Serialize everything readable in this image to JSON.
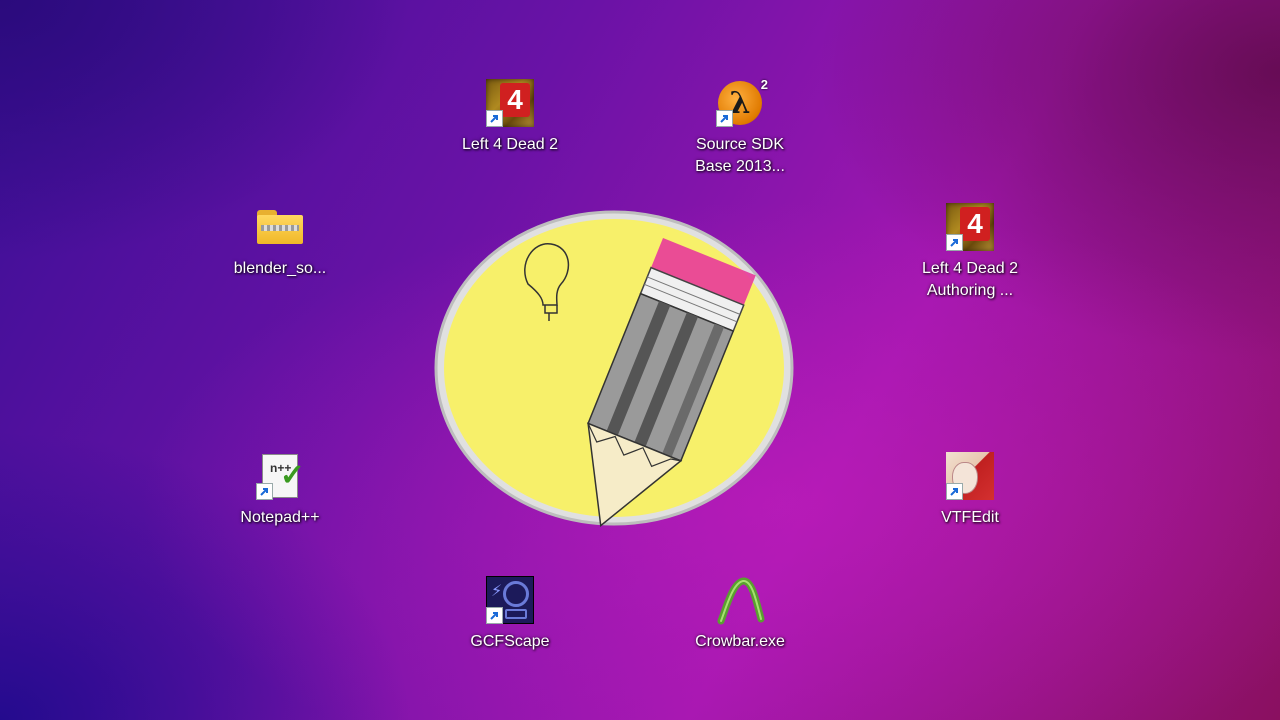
{
  "desktop": {
    "icons": [
      {
        "label": "Left 4 Dead 2",
        "icon": "left4dead2-icon",
        "shortcut": true
      },
      {
        "label": "Source SDK\nBase 2013...",
        "icon": "source-sdk-icon",
        "shortcut": true
      },
      {
        "label": "blender_so...",
        "icon": "zip-folder-icon",
        "shortcut": false
      },
      {
        "label": "Left 4 Dead 2\nAuthoring ...",
        "icon": "left4dead2-authoring-icon",
        "shortcut": true
      },
      {
        "label": "Notepad++",
        "icon": "notepad-plus-plus-icon",
        "shortcut": true
      },
      {
        "label": "VTFEdit",
        "icon": "vtfedit-icon",
        "shortcut": true
      },
      {
        "label": "GCFScape",
        "icon": "gcfscape-icon",
        "shortcut": true
      },
      {
        "label": "Crowbar.exe",
        "icon": "crowbar-icon",
        "shortcut": false
      }
    ],
    "center_logo": "pencil-logo"
  },
  "colors": {
    "logo_fill": "#f7f06a",
    "logo_ring": "#d8d8d8",
    "accent_red": "#d02020",
    "crowbar_green": "#5aa030"
  }
}
